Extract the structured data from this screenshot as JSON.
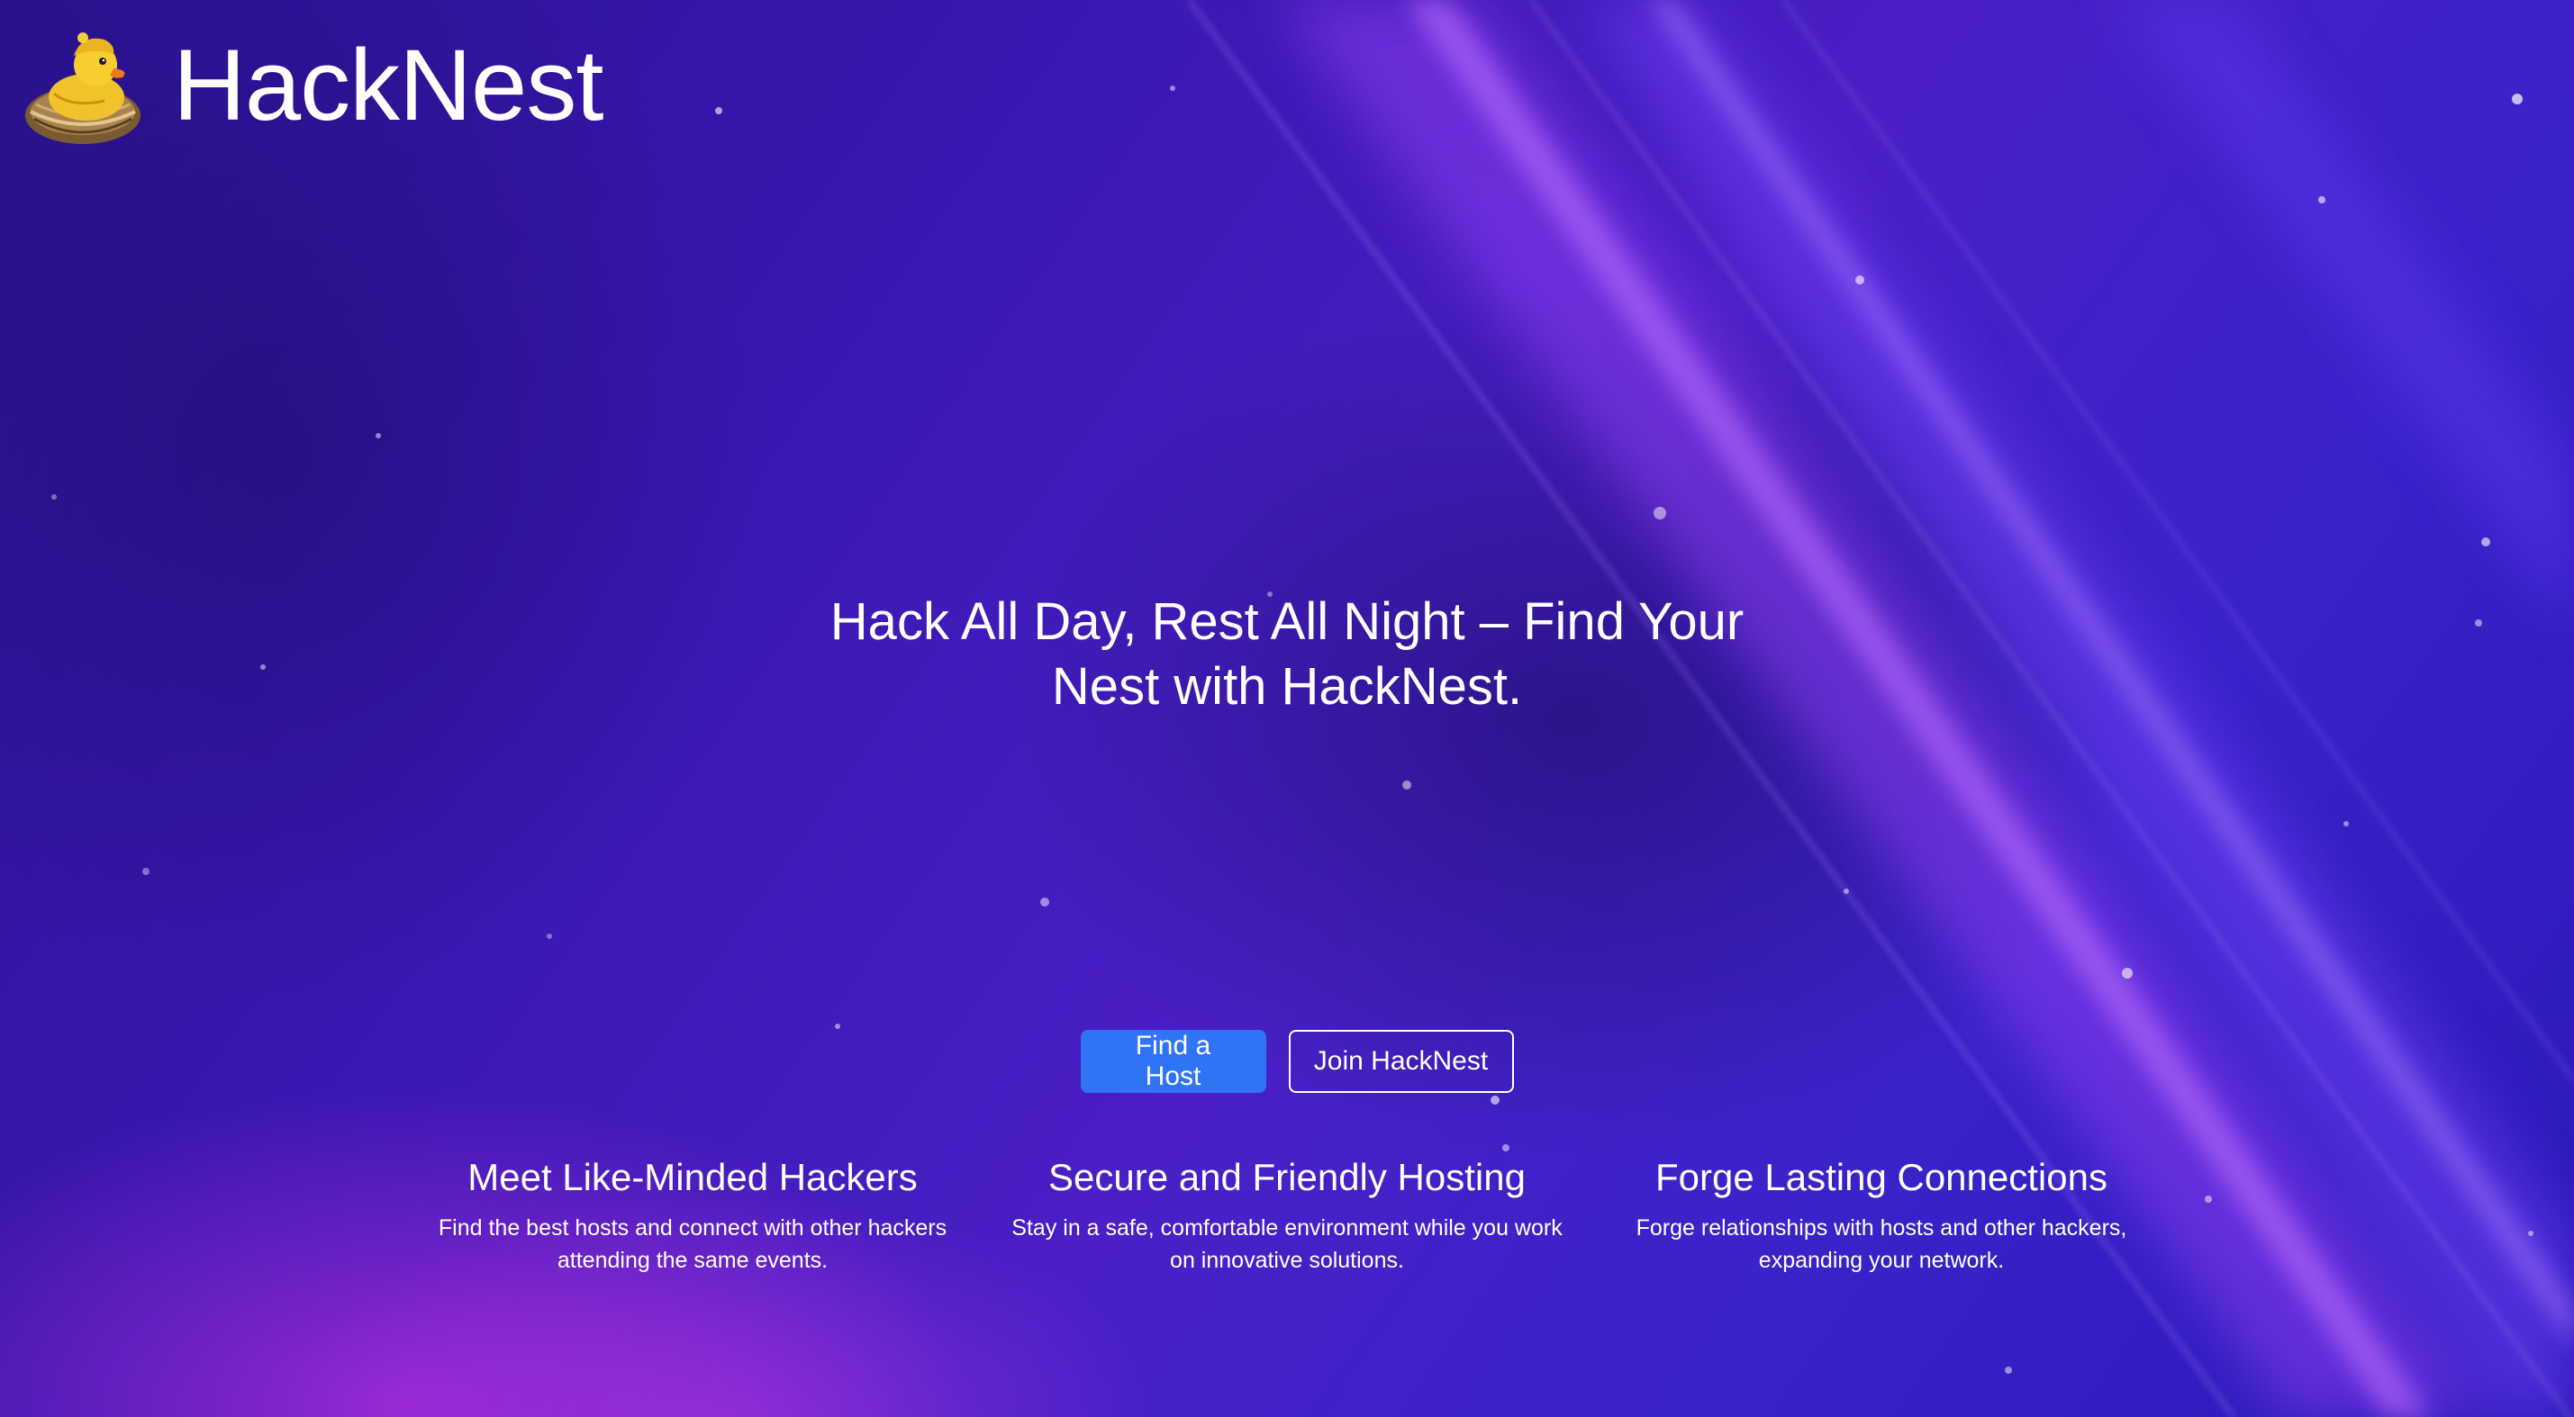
{
  "brand": {
    "name": "HackNest",
    "logo_icon": "duck-in-nest-icon"
  },
  "hero": {
    "headline": "Hack All Day, Rest All Night – Find Your Nest with HackNest."
  },
  "actions": {
    "primary_label": "Find a Host",
    "secondary_label": "Join HackNest"
  },
  "features": [
    {
      "title": "Meet Like-Minded Hackers",
      "description": "Find the best hosts and connect with other hackers attending the same events."
    },
    {
      "title": "Secure and Friendly Hosting",
      "description": "Stay in a safe, comfortable environment while you work on innovative solutions."
    },
    {
      "title": "Forge Lasting Connections",
      "description": "Forge relationships with hosts and other hackers, expanding your network."
    }
  ],
  "colors": {
    "background": "#3a17b2",
    "primary_button": "#2f74f5",
    "text": "#ffffff",
    "glow": "#d634e6"
  }
}
